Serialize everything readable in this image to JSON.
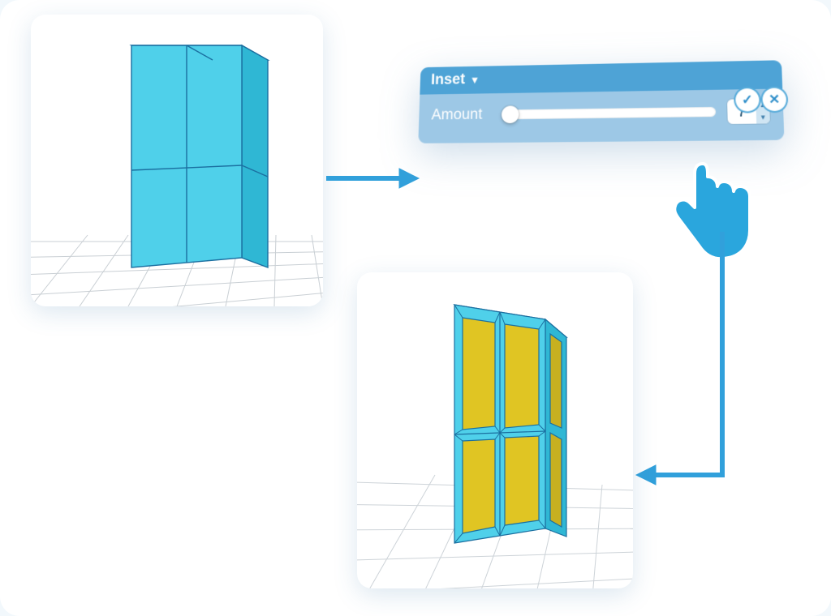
{
  "diagram": {
    "purpose": "Illustration of applying the Inset tool to a 3D box model",
    "steps": [
      "before-model",
      "tool-panel",
      "after-model"
    ]
  },
  "tool": {
    "name": "Inset",
    "dropdown_icon": "▼",
    "parameter_label": "Amount",
    "parameter_value": "7",
    "slider_position": 0.02,
    "confirm_icon": "✓",
    "cancel_icon": "✕"
  },
  "colors": {
    "panel_header": "#4ea3d6",
    "panel_body": "#9dc8e6",
    "accent": "#31a0db",
    "model_face": "#4fd0ea",
    "model_edge": "#1b6fa0",
    "selected_face": "#e0c523"
  },
  "viewports": {
    "before_alt": "Cyan 3D box with four front faces on a grid floor",
    "after_alt": "Same box after inset: each face has a smaller inset yellow face"
  }
}
